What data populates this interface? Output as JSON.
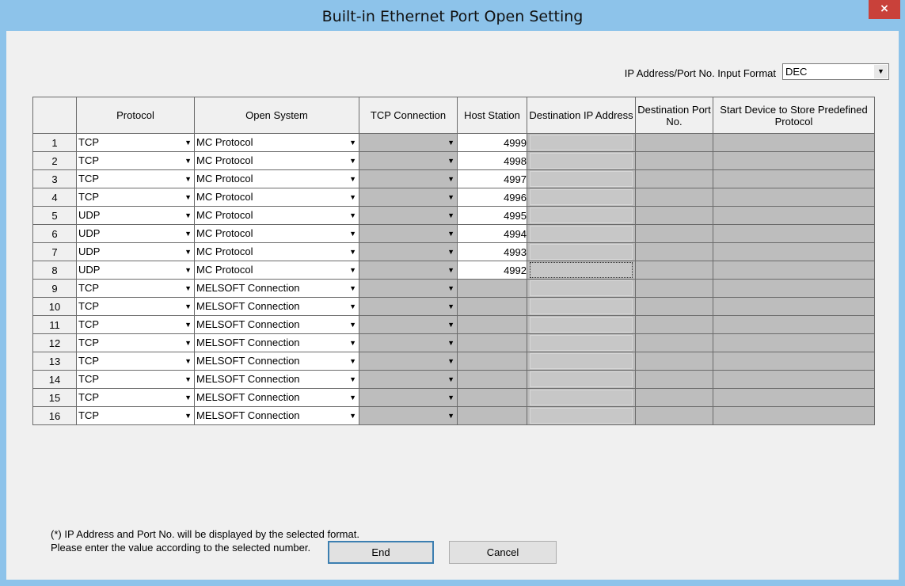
{
  "window": {
    "title": "Built-in Ethernet Port Open Setting",
    "close_label": "×"
  },
  "input_format": {
    "label": "IP Address/Port No. Input Format",
    "value": "DEC"
  },
  "table": {
    "headers": [
      "",
      "Protocol",
      "Open System",
      "TCP Connection",
      "Host Station",
      "Destination IP Address",
      "Destination Port No.",
      "Start Device to Store Predefined Protocol"
    ],
    "rows": [
      {
        "no": "1",
        "protocol": "TCP",
        "open_system": "MC Protocol",
        "tcp_connection": "",
        "host_station": "4999"
      },
      {
        "no": "2",
        "protocol": "TCP",
        "open_system": "MC Protocol",
        "tcp_connection": "",
        "host_station": "4998"
      },
      {
        "no": "3",
        "protocol": "TCP",
        "open_system": "MC Protocol",
        "tcp_connection": "",
        "host_station": "4997"
      },
      {
        "no": "4",
        "protocol": "TCP",
        "open_system": "MC Protocol",
        "tcp_connection": "",
        "host_station": "4996"
      },
      {
        "no": "5",
        "protocol": "UDP",
        "open_system": "MC Protocol",
        "tcp_connection": "",
        "host_station": "4995"
      },
      {
        "no": "6",
        "protocol": "UDP",
        "open_system": "MC Protocol",
        "tcp_connection": "",
        "host_station": "4994"
      },
      {
        "no": "7",
        "protocol": "UDP",
        "open_system": "MC Protocol",
        "tcp_connection": "",
        "host_station": "4993"
      },
      {
        "no": "8",
        "protocol": "UDP",
        "open_system": "MC Protocol",
        "tcp_connection": "",
        "host_station": "4992"
      },
      {
        "no": "9",
        "protocol": "TCP",
        "open_system": "MELSOFT Connection",
        "tcp_connection": "",
        "host_station": ""
      },
      {
        "no": "10",
        "protocol": "TCP",
        "open_system": "MELSOFT Connection",
        "tcp_connection": "",
        "host_station": ""
      },
      {
        "no": "11",
        "protocol": "TCP",
        "open_system": "MELSOFT Connection",
        "tcp_connection": "",
        "host_station": ""
      },
      {
        "no": "12",
        "protocol": "TCP",
        "open_system": "MELSOFT Connection",
        "tcp_connection": "",
        "host_station": ""
      },
      {
        "no": "13",
        "protocol": "TCP",
        "open_system": "MELSOFT Connection",
        "tcp_connection": "",
        "host_station": ""
      },
      {
        "no": "14",
        "protocol": "TCP",
        "open_system": "MELSOFT Connection",
        "tcp_connection": "",
        "host_station": ""
      },
      {
        "no": "15",
        "protocol": "TCP",
        "open_system": "MELSOFT Connection",
        "tcp_connection": "",
        "host_station": ""
      },
      {
        "no": "16",
        "protocol": "TCP",
        "open_system": "MELSOFT Connection",
        "tcp_connection": "",
        "host_station": ""
      }
    ]
  },
  "notes": {
    "line1": "(*) IP Address and Port No. will be displayed by the selected format.",
    "line2": "Please enter the value according to the selected number."
  },
  "buttons": {
    "end": "End",
    "cancel": "Cancel"
  },
  "colors": {
    "title_bar": "#8dc3ea",
    "close": "#c9413a",
    "disabled_cell": "#bdbdbd"
  },
  "icons": {
    "dropdown": "triangle-down-icon",
    "close": "close-icon"
  }
}
